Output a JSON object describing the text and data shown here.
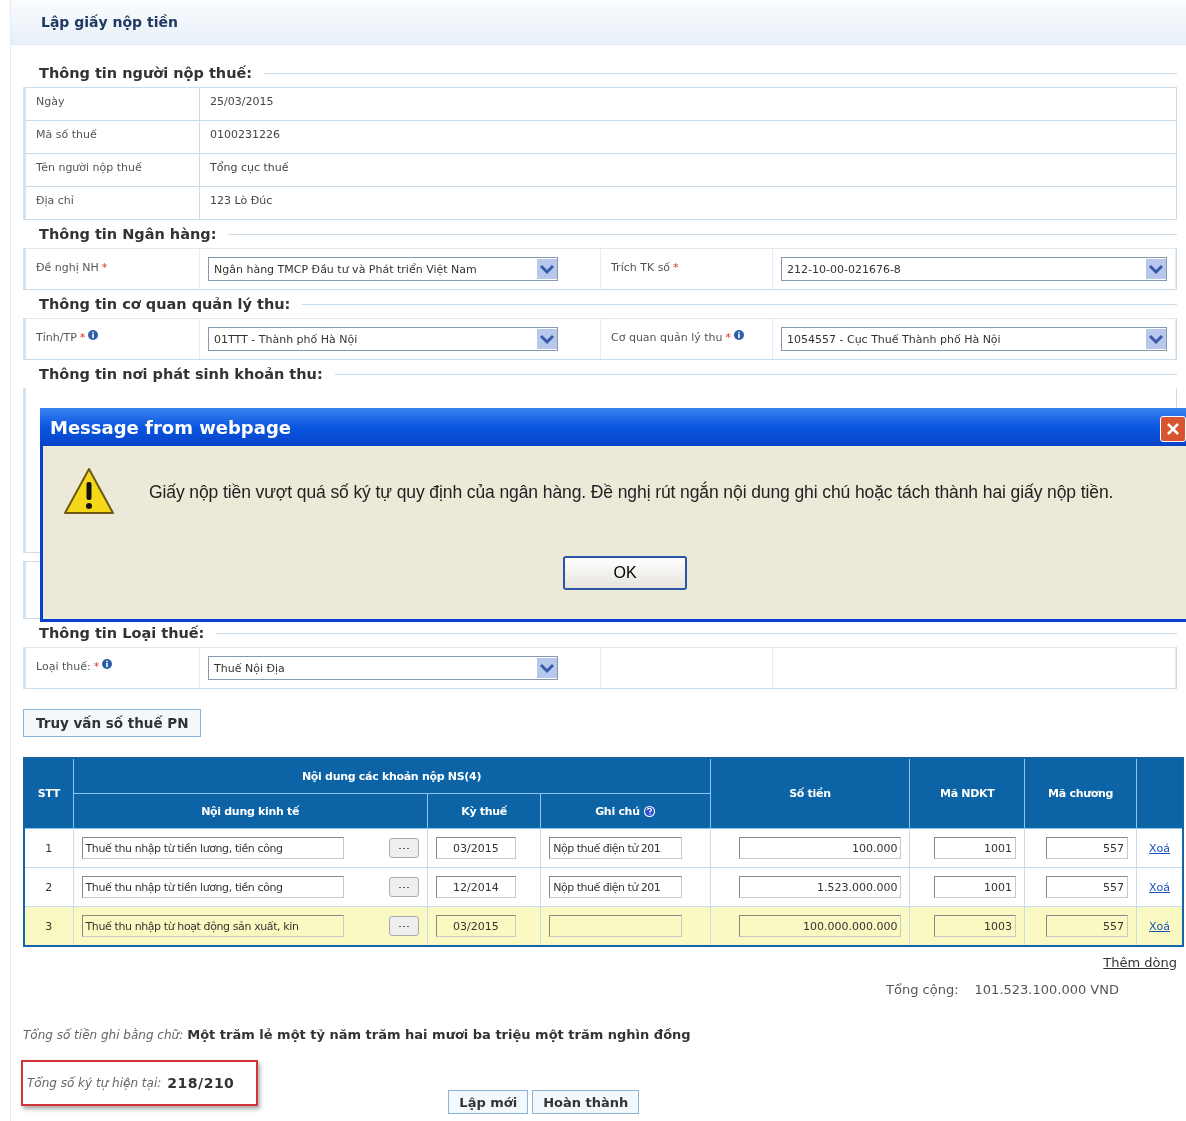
{
  "page_title": "Lập giấy nộp tiền",
  "taxpayer": {
    "legend": "Thông tin người nộp thuế:",
    "rows": [
      {
        "label": "Ngày",
        "value": "25/03/2015"
      },
      {
        "label": "Mã số thuế",
        "value": "0100231226"
      },
      {
        "label": "Tên người nộp thuế",
        "value": "Tổng cục thuế"
      },
      {
        "label": "Địa chỉ",
        "value": "123 Lò Đúc"
      }
    ]
  },
  "bank": {
    "legend": "Thông tin Ngân hàng:",
    "fields": [
      {
        "label": "Đề nghị NH",
        "mark": "*",
        "info": false,
        "value": "Ngân hàng TMCP Đầu tư và Phát triển Việt Nam"
      },
      {
        "label": "Trích TK số",
        "mark": "*",
        "info": false,
        "value": "212-10-00-021676-8"
      }
    ]
  },
  "authority": {
    "legend": "Thông tin cơ quan quản lý thu:",
    "fields": [
      {
        "label": "Tỉnh/TP",
        "mark": "*",
        "info": true,
        "value": "01TTT - Thành phố Hà Nội"
      },
      {
        "label": "Cơ quan quản lý thu",
        "mark": "*",
        "info": true,
        "value": "1054557 - Cục Thuế Thành phố Hà Nội"
      }
    ]
  },
  "origin": {
    "legend": "Thông tin nơi phát sinh khoản thu:"
  },
  "tax_type": {
    "legend": "Thông tin Loại thuế:",
    "fields": [
      {
        "label": "Loại thuế:",
        "mark": "*",
        "info": true,
        "value": "Thuế Nội Địa"
      }
    ]
  },
  "query_button": "Truy vấn số thuế PN",
  "table": {
    "group_header": "Nội dung các khoản nộp NS(4)",
    "columns": [
      "STT",
      "Nội dung kinh tế",
      "Kỳ thuế",
      "Ghi chú",
      "Số tiền",
      "Mã NDKT",
      "Mã chương"
    ],
    "rows": [
      {
        "stt": "1",
        "content": "Thuế thu nhập từ tiền lương, tiền công",
        "period": "03/2015",
        "note": "Nộp thuế điện tử 201",
        "amount": "100.000",
        "code": "1001",
        "chapter": "557",
        "action": "Xoá",
        "selected": false
      },
      {
        "stt": "2",
        "content": "Thuế thu nhập từ tiền lương, tiền công",
        "period": "12/2014",
        "note": "Nộp thuế điện tử 201",
        "amount": "1.523.000.000",
        "code": "1001",
        "chapter": "557",
        "action": "Xoá",
        "selected": false
      },
      {
        "stt": "3",
        "content": "Thuế thu nhập từ hoạt động sản xuất, kin",
        "period": "03/2015",
        "note": "",
        "amount": "100.000.000.000",
        "code": "1003",
        "chapter": "557",
        "action": "Xoá",
        "selected": true
      }
    ]
  },
  "add_row": "Thêm dòng",
  "total": {
    "label": "Tổng cộng:",
    "value": "101.523.100.000 VND"
  },
  "words": {
    "label": "Tổng số tiền ghi bằng chữ:",
    "value": "Một trăm lẻ một tỷ năm trăm hai mươi ba triệu một trăm nghìn đồng"
  },
  "char_count": {
    "label": "Tổng số ký tự hiện tại:",
    "value": "218/210"
  },
  "buttons": [
    "Lập mới",
    "Hoàn thành"
  ],
  "dialog": {
    "title": "Message from webpage",
    "message": "Giấy nộp tiền vượt quá số ký tự quy định của ngân hàng. Đề nghị rút ngắn nội dung ghi chú hoặc tách thành hai giấy nộp tiền.",
    "ok": "OK"
  }
}
